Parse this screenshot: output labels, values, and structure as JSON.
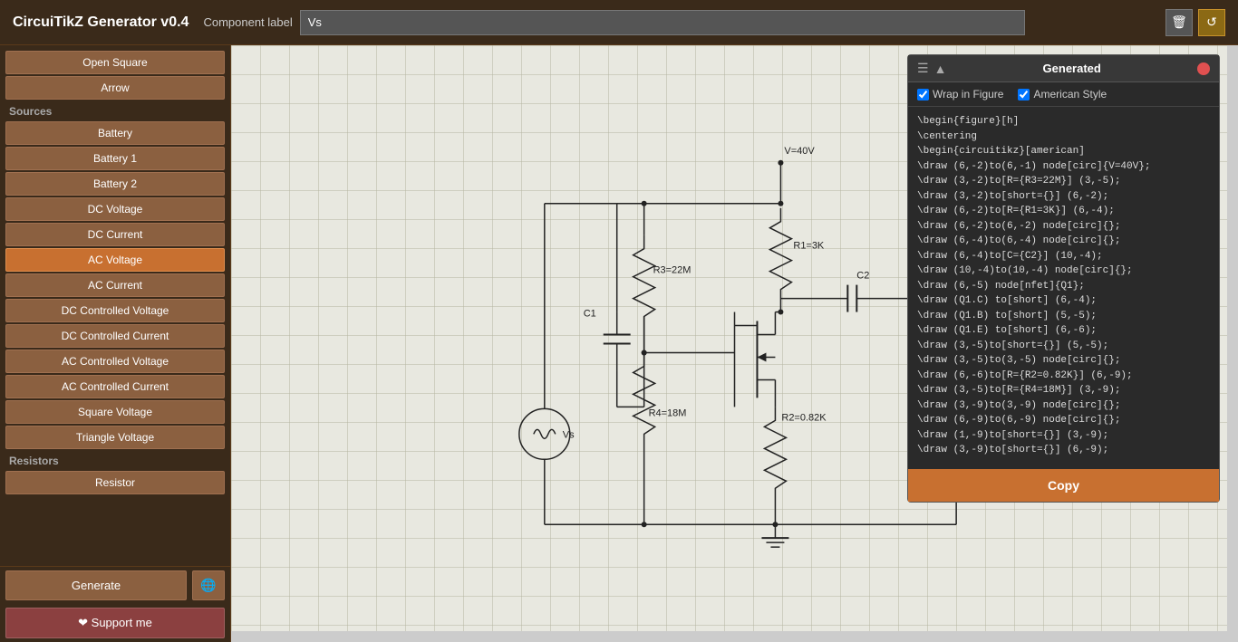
{
  "app": {
    "title": "CircuiTikZ Generator v0.4"
  },
  "header": {
    "component_label": "Component label",
    "label_value": "Vs",
    "delete_icon": "🗑",
    "refresh_icon": "↺"
  },
  "sidebar": {
    "sections": [
      {
        "label": "",
        "items": [
          {
            "id": "open-square",
            "label": "Open Square",
            "active": false
          },
          {
            "id": "arrow",
            "label": "Arrow",
            "active": false
          }
        ]
      },
      {
        "label": "Sources",
        "items": [
          {
            "id": "battery",
            "label": "Battery",
            "active": false
          },
          {
            "id": "battery1",
            "label": "Battery 1",
            "active": false
          },
          {
            "id": "battery2",
            "label": "Battery 2",
            "active": false
          },
          {
            "id": "dc-voltage",
            "label": "DC Voltage",
            "active": false
          },
          {
            "id": "dc-current",
            "label": "DC Current",
            "active": false
          },
          {
            "id": "ac-voltage",
            "label": "AC Voltage",
            "active": true
          },
          {
            "id": "ac-current",
            "label": "AC Current",
            "active": false
          },
          {
            "id": "dc-controlled-voltage",
            "label": "DC Controlled Voltage",
            "active": false
          },
          {
            "id": "dc-controlled-current",
            "label": "DC Controlled Current",
            "active": false
          },
          {
            "id": "ac-controlled-voltage",
            "label": "AC Controlled Voltage",
            "active": false
          },
          {
            "id": "ac-controlled-current",
            "label": "AC Controlled Current",
            "active": false
          },
          {
            "id": "square-voltage",
            "label": "Square Voltage",
            "active": false
          },
          {
            "id": "triangle-voltage",
            "label": "Triangle Voltage",
            "active": false
          }
        ]
      },
      {
        "label": "Resistors",
        "items": [
          {
            "id": "resistor",
            "label": "Resistor",
            "active": false
          }
        ]
      }
    ],
    "bottom": {
      "generate": "Generate",
      "globe": "🌐",
      "support": "❤ Support me"
    }
  },
  "panel": {
    "title": "Generated",
    "wrap_label": "Wrap in Figure",
    "american_label": "American Style",
    "wrap_checked": true,
    "american_checked": true,
    "copy_label": "Copy",
    "code_lines": [
      "\\begin{figure}[h]",
      "\\centering",
      "\\begin{circuitikz}[american]",
      "\\draw (6,-2)to(6,-1) node[circ]{V=40V};",
      "\\draw (3,-2)to[R={R3=22M}] (3,-5);",
      "\\draw (3,-2)to[short={}] (6,-2);",
      "\\draw (6,-2)to[R={R1=3K}] (6,-4);",
      "\\draw (6,-2)to(6,-2) node[circ]{};",
      "\\draw (6,-4)to(6,-4) node[circ]{};",
      "\\draw (6,-4)to[C={C2}] (10,-4);",
      "\\draw (10,-4)to(10,-4) node[circ]{};",
      "\\draw (6,-5) node[nfet]{Q1};",
      "\\draw (Q1.C) to[short] (6,-4);",
      "\\draw (Q1.B) to[short] (5,-5);",
      "\\draw (Q1.E) to[short] (6,-6);",
      "\\draw (3,-5)to[short={}] (5,-5);",
      "\\draw (3,-5)to(3,-5) node[circ]{};",
      "\\draw (6,-6)to[R={R2=0.82K}] (6,-9);",
      "\\draw (3,-5)to[R={R4=18M}] (3,-9);",
      "\\draw (3,-9)to(3,-9) node[circ]{};",
      "\\draw (6,-9)to(6,-9) node[circ]{};",
      "\\draw (1,-9)to[short={}] (3,-9);",
      "\\draw (3,-9)to[short={}] (6,-9);"
    ]
  },
  "canvas": {
    "circuit_components": {
      "vs_label": "Vs",
      "v40v_label": "V=40V",
      "r3_label": "R3=22M",
      "r1_label": "R1=3K",
      "r2_label": "R2=0.82K",
      "r4_label": "R4=18M",
      "c1_label": "C1",
      "c2_label": "C2"
    }
  }
}
